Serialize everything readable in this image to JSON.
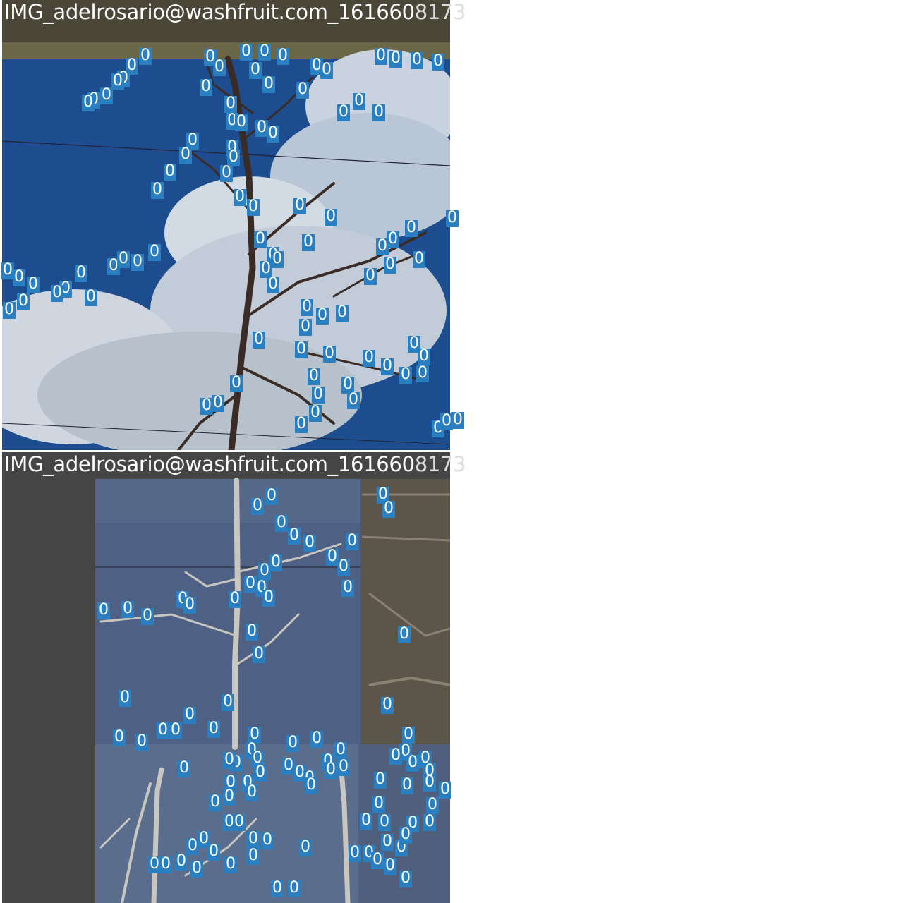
{
  "tiles": [
    {
      "caption_text": "IMG_adelrosario@washfruit.com_161660",
      "caption_tail": "8173"
    },
    {
      "caption_text": "IMG_adelrosario@washfruit.com_161660",
      "caption_tail": "8173"
    }
  ],
  "detection_label": "0",
  "colors": {
    "box": "#2a7fc1",
    "label_text": "#ffffff",
    "sky": "#1c4a8f",
    "dark_pad": "#444444"
  }
}
